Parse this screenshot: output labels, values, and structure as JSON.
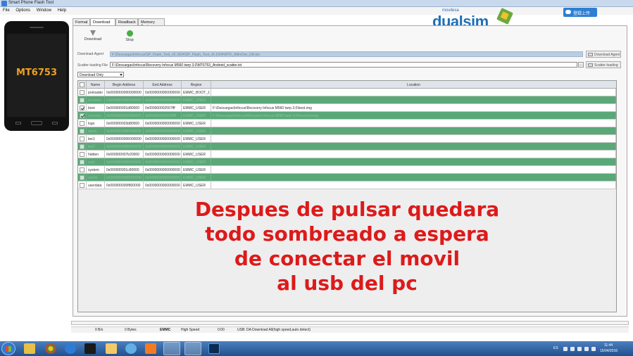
{
  "window": {
    "title": "Smart Phone Flash Tool",
    "menu": [
      "File",
      "Options",
      "Window",
      "Help"
    ]
  },
  "branding": {
    "small_text": "movilesa",
    "logo_text": "dualsim",
    "login_button": "登録上传"
  },
  "phone": {
    "chip_label": "MT6753"
  },
  "tabs": [
    {
      "label": "Format",
      "active": false
    },
    {
      "label": "Download",
      "active": true
    },
    {
      "label": "Readback",
      "active": false
    },
    {
      "label": "Memory Test",
      "active": false
    }
  ],
  "toolbar": {
    "download_label": "Download",
    "stop_label": "Stop"
  },
  "agent": {
    "label": "Download-Agent",
    "value": "F:\\Descargas\\Infocus\\SP_Flash_Tool_v5.1604\\SP_Flash_Tool_v5.1604\\MTK_AllInOne_DA.bin",
    "button": "Download Agent"
  },
  "scatter": {
    "label": "Scatter-loading File",
    "value": "F:\\Descargas\\Infocus\\Recovery Infocus M560 twrp 3.0\\MT6753_Android_scatter.txt",
    "dots": "...",
    "button": "Scatter-loading"
  },
  "mode_select": {
    "selected": "Download Only"
  },
  "table": {
    "headers": [
      "",
      "Name",
      "Begin Address",
      "End Address",
      "Region",
      "Location"
    ],
    "rows": [
      {
        "style": "plain",
        "checked": false,
        "name": "preloader",
        "begin": "0x0000000000000000",
        "end": "0x0000000000000000",
        "region": "EMMC_BOOT_1",
        "location": ""
      },
      {
        "style": "green",
        "checked": false,
        "name": "recovery",
        "begin": "0x0000000000000000",
        "end": "0x0000000000000000",
        "region": "EMMC_USER",
        "location": ""
      },
      {
        "style": "plain",
        "checked": true,
        "name": "boot",
        "begin": "0x000000001d80000",
        "end": "0x000000002567fff",
        "region": "EMMC_USER",
        "location": "F:\\Descargas\\Infocus\\Recovery Infocus M560 twrp 3.0\\boot.img"
      },
      {
        "style": "green",
        "checked": true,
        "name": "recovery",
        "begin": "0x0000000002580000",
        "end": "0x0000000002d7ffff",
        "region": "EMMC_USER",
        "location": "F:\\Descargas\\Infocus\\Recovery Infocus M560 twrp 3.0\\recovery.img"
      },
      {
        "style": "plain",
        "checked": false,
        "name": "logo",
        "begin": "0x000000003d80000",
        "end": "0x0000000000000000",
        "region": "EMMC_USER",
        "location": ""
      },
      {
        "style": "green",
        "checked": false,
        "name": "secro",
        "begin": "0x0000000000000000",
        "end": "0x0000000000000000",
        "region": "EMMC_USER",
        "location": ""
      },
      {
        "style": "plain",
        "checked": false,
        "name": "tee1",
        "begin": "0x0000000006000000",
        "end": "0x0000000000000000",
        "region": "EMMC_USER",
        "location": ""
      },
      {
        "style": "green",
        "checked": false,
        "name": "tee2",
        "begin": "0x0000000000000000",
        "end": "0x0000000000000000",
        "region": "EMMC_USER",
        "location": ""
      },
      {
        "style": "plain",
        "checked": false,
        "name": "hidden",
        "begin": "0x000000007b20000",
        "end": "0x0000000000000000",
        "region": "EMMC_USER",
        "location": ""
      },
      {
        "style": "green",
        "checked": false,
        "name": "cust",
        "begin": "0x0000000000000000",
        "end": "0x0000000000000000",
        "region": "EMMC_USER",
        "location": ""
      },
      {
        "style": "plain",
        "checked": false,
        "name": "system",
        "begin": "0x000000001c80000",
        "end": "0x0000000000000000",
        "region": "EMMC_USER",
        "location": ""
      },
      {
        "style": "green",
        "checked": false,
        "name": "cache",
        "begin": "0x0000000000000000",
        "end": "0x0000000000000000",
        "region": "EMMC_USER",
        "location": ""
      },
      {
        "style": "plain",
        "checked": false,
        "name": "userdata",
        "begin": "0x000000000f800000",
        "end": "0x0000000000000000",
        "region": "EMMC_USER",
        "location": ""
      }
    ]
  },
  "caption": [
    "Despues de pulsar quedara",
    "todo sombreado a espera",
    "de conectar el movil",
    "al usb del pc"
  ],
  "status": {
    "speed": "0 B/s",
    "bytes": "0 Bytes",
    "storage": "EMMC",
    "usb_speed": "High Speed",
    "time": "0:00",
    "message": "USB: DA Download All(high speed,auto detect)"
  },
  "taskbar": {
    "lang": "ES",
    "time": "11:44",
    "date": "15/04/2016"
  },
  "colors": {
    "row_green": "#5aa878",
    "caption_red": "#dd1a1a",
    "brand_blue": "#1f6fb5"
  }
}
